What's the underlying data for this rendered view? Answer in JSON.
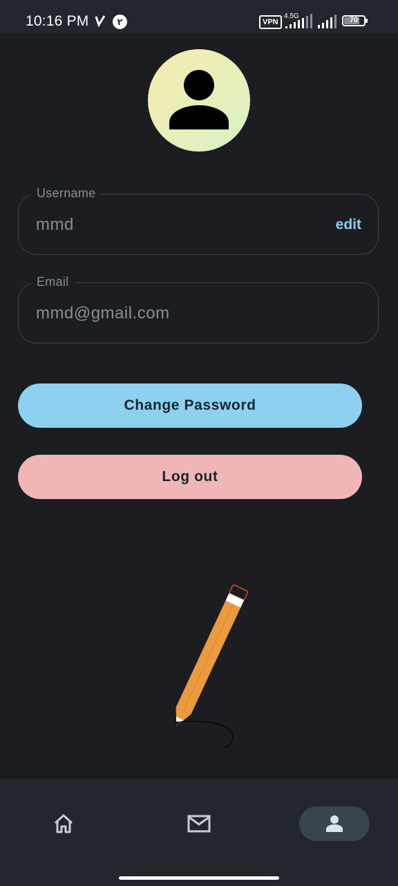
{
  "status_bar": {
    "time": "10:16 PM",
    "notification_badge": "۲",
    "vpn_label": "VPN",
    "network_label": "4.5G",
    "battery_level": "70"
  },
  "profile": {
    "avatar_icon": "person-icon",
    "username_field": {
      "label": "Username",
      "value": "mmd",
      "action_label": "edit"
    },
    "email_field": {
      "label": "Email",
      "value": "mmd@gmail.com"
    }
  },
  "actions": {
    "change_password_label": "Change Password",
    "logout_label": "Log out"
  },
  "illustration": {
    "icon": "pencil-icon"
  },
  "bottom_nav": {
    "items": [
      {
        "icon": "home-icon",
        "active": false
      },
      {
        "icon": "mail-icon",
        "active": false
      },
      {
        "icon": "person-icon",
        "active": true
      }
    ]
  },
  "colors": {
    "background": "#1b1d20",
    "bar_background": "#22272e",
    "accent_blue": "#8dd0ef",
    "accent_pink": "#f0b6b5",
    "edit_link": "#88cfee"
  }
}
